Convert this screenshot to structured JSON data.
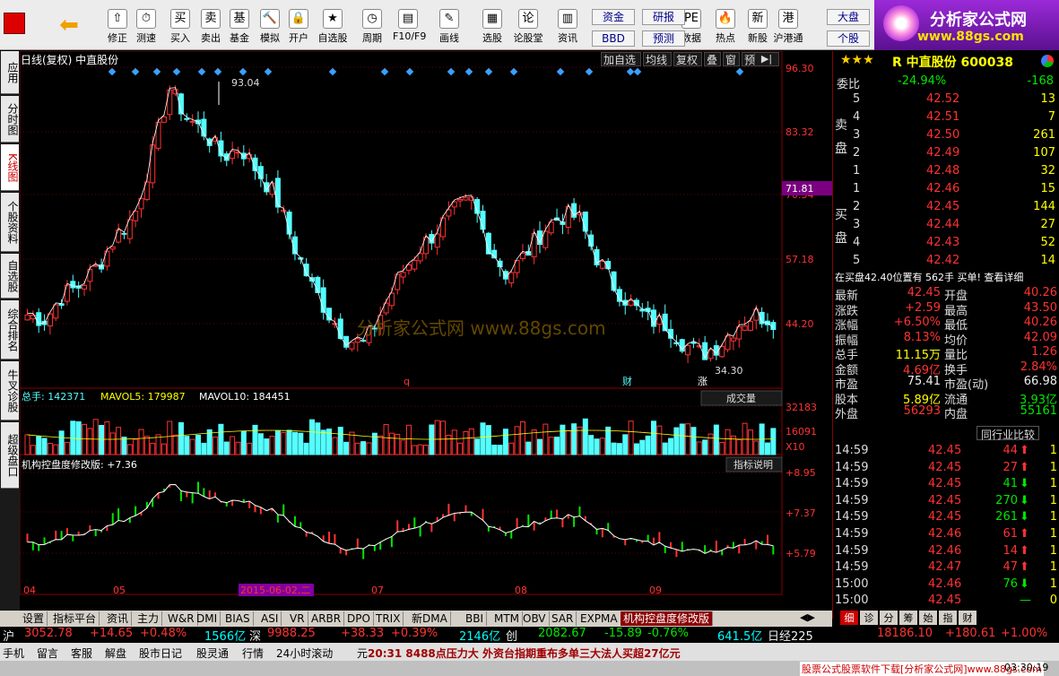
{
  "toolbar": {
    "buttons": [
      {
        "id": "revise",
        "label": "修正"
      },
      {
        "id": "test",
        "label": "测速"
      },
      {
        "id": "buy",
        "label": "买入"
      },
      {
        "id": "sell",
        "label": "卖出"
      },
      {
        "id": "fund",
        "label": "基金"
      },
      {
        "id": "sim",
        "label": "模拟"
      },
      {
        "id": "open",
        "label": "开户"
      },
      {
        "id": "watch",
        "label": "自选股"
      },
      {
        "id": "period",
        "label": "周期"
      },
      {
        "id": "f10",
        "label": "F10/F9"
      },
      {
        "id": "draw",
        "label": "画线"
      },
      {
        "id": "pick",
        "label": "选股"
      },
      {
        "id": "forum",
        "label": "论股堂"
      },
      {
        "id": "news",
        "label": "资讯"
      },
      {
        "id": "data",
        "label": "数据"
      },
      {
        "id": "hot",
        "label": "热点"
      },
      {
        "id": "newstock",
        "label": "新股"
      },
      {
        "id": "hk",
        "label": "沪港通"
      }
    ],
    "small": [
      "资金",
      "BBD",
      "研报",
      "预测",
      "大盘",
      "个股"
    ],
    "logo": "分析家公式网",
    "logo_url": "www.88gs.com"
  },
  "left_tabs": [
    "应用",
    "分时图",
    "K线图",
    "个股资料",
    "自选股",
    "综合排名",
    "牛叉诊股",
    "超级盘口"
  ],
  "chart_header": {
    "title": "日线(复权) 中直股份",
    "buttons": [
      "加自选",
      "均线",
      "复权",
      "叠",
      "窗",
      "预测"
    ]
  },
  "main_axis": [
    "96.30",
    "83.32",
    "70.34",
    "57.18",
    "44.20"
  ],
  "price_tag": "71.81",
  "annotations": {
    "high": "93.04",
    "low": "34.30",
    "q": "q",
    "cai": "财",
    "zhang": "涨"
  },
  "watermark": "分析家公式网  www.88gs.com",
  "vol_header": {
    "total": "总手: 142371",
    "mavol5": "MAVOL5: 179987",
    "mavol10": "MAVOL10: 184451",
    "dropdown": "成交量",
    "axis": [
      "32183",
      "16091",
      "X10"
    ]
  },
  "ind_header": {
    "name": "机构控盘度修改版: +7.36",
    "button": "指标说明",
    "axis": [
      "+8.95",
      "+7.37",
      "+5.79"
    ]
  },
  "dates": [
    "04",
    "05",
    "2015-06-02,二",
    "07",
    "08",
    "09"
  ],
  "bottom_tabs": [
    "设置",
    "指标平台",
    "资讯",
    "主力",
    "W&R",
    "DMI",
    "BIAS",
    "ASI",
    "VR",
    "ARBR",
    "DPO",
    "TRIX",
    "新DMA",
    "BBI",
    "MTM",
    "OBV",
    "SAR",
    "EXPMA",
    "机构控盘度修改版"
  ],
  "quote": {
    "name": "R 中直股份 600038",
    "weibi_label": "委比",
    "weibi": "-24.94%",
    "weicha": "-168",
    "sell": [
      {
        "n": "5",
        "p": "42.52",
        "v": "13"
      },
      {
        "n": "4",
        "p": "42.51",
        "v": "7"
      },
      {
        "n": "3",
        "p": "42.50",
        "v": "261"
      },
      {
        "n": "2",
        "p": "42.49",
        "v": "107"
      },
      {
        "n": "1",
        "p": "42.48",
        "v": "32"
      }
    ],
    "buy": [
      {
        "n": "1",
        "p": "42.46",
        "v": "15"
      },
      {
        "n": "2",
        "p": "42.45",
        "v": "144"
      },
      {
        "n": "3",
        "p": "42.44",
        "v": "27"
      },
      {
        "n": "4",
        "p": "42.43",
        "v": "52"
      },
      {
        "n": "5",
        "p": "42.42",
        "v": "14"
      }
    ],
    "sell_label": "卖盘",
    "buy_label": "买盘",
    "notice": "在买盘42.40位置有  562手  买单! 查看详细",
    "stats": [
      [
        "最新",
        "42.45",
        "开盘",
        "40.26"
      ],
      [
        "涨跌",
        "+2.59",
        "最高",
        "43.50"
      ],
      [
        "涨幅",
        "+6.50%",
        "最低",
        "40.26"
      ],
      [
        "振幅",
        "8.13%",
        "均价",
        "42.09"
      ],
      [
        "总手",
        "11.15万",
        "量比",
        "1.26"
      ],
      [
        "金额",
        "4.69亿",
        "换手",
        "2.84%"
      ],
      [
        "市盈",
        "75.41",
        "市盈(动)",
        "66.98"
      ],
      [
        "股本",
        "5.89亿",
        "流通",
        "3.93亿"
      ],
      [
        "外盘",
        "56293",
        "内盘",
        "55161"
      ]
    ],
    "compare": "同行业比较",
    "ticks": [
      [
        "14:59",
        "42.45",
        "44",
        "up",
        "1"
      ],
      [
        "14:59",
        "42.45",
        "27",
        "up",
        "1"
      ],
      [
        "14:59",
        "42.45",
        "41",
        "dn",
        "1"
      ],
      [
        "14:59",
        "42.45",
        "270",
        "dn",
        "1"
      ],
      [
        "14:59",
        "42.45",
        "261",
        "dn",
        "1"
      ],
      [
        "14:59",
        "42.46",
        "61",
        "up",
        "1"
      ],
      [
        "14:59",
        "42.46",
        "14",
        "up",
        "1"
      ],
      [
        "14:59",
        "42.47",
        "47",
        "up",
        "1"
      ],
      [
        "15:00",
        "42.46",
        "76",
        "dn",
        "1"
      ],
      [
        "15:00",
        "42.45",
        "",
        "",
        "0"
      ]
    ],
    "right_tabs": [
      "细",
      "诊",
      "分",
      "筹",
      "始",
      "指",
      "财"
    ]
  },
  "index_bar": {
    "sh": "沪",
    "sh_val": "3052.78",
    "sh_chg": "+14.65",
    "sh_pct": "+0.48%",
    "sh_amt": "1566亿",
    "sz": "深",
    "sz_val": "9988.25",
    "sz_chg": "+38.33",
    "sz_pct": "+0.39%",
    "sz_amt": "2146亿",
    "cy": "创",
    "cy_val": "2082.67",
    "cy_chg": "-15.89",
    "cy_pct": "-0.76%",
    "cy_amt": "641.5亿",
    "rj": "日经225",
    "rj_val": "18186.10",
    "rj_chg": "+180.61",
    "rj_pct": "+1.00%"
  },
  "status_bar": {
    "items": [
      "手机",
      "留言",
      "客服",
      "解盘",
      "股市日记",
      "股灵通",
      "行情",
      "24小时滚动",
      "元"
    ],
    "news": "20:31 8488点压力大 外资台指期重布多单三大法人买超27亿元",
    "ad": "股票公式股票软件下载[分析家公式网]www.88gs.com",
    "time": "03:30:19"
  }
}
